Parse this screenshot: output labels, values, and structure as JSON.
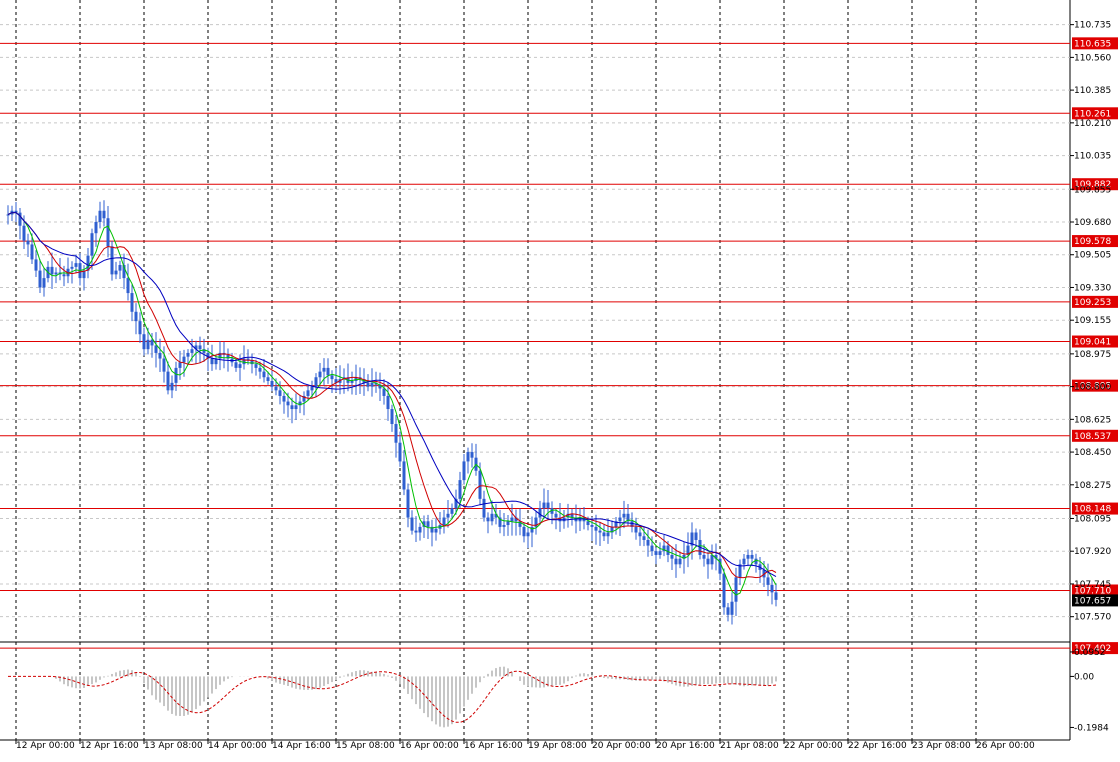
{
  "chart_data": [
    {
      "type": "candlestick",
      "ylim": [
        107.44,
        110.84
      ],
      "y_ticks": [
        "110.735",
        "110.560",
        "110.385",
        "110.210",
        "110.035",
        "109.855",
        "109.680",
        "109.505",
        "109.330",
        "109.155",
        "108.975",
        "108.800",
        "108.625",
        "108.450",
        "108.275",
        "108.095",
        "107.920",
        "107.745",
        "107.570"
      ],
      "y_tick_values": [
        110.735,
        110.56,
        110.385,
        110.21,
        110.035,
        109.855,
        109.68,
        109.505,
        109.33,
        109.155,
        108.975,
        108.8,
        108.625,
        108.45,
        108.275,
        108.095,
        107.92,
        107.745,
        107.57
      ],
      "x_ticks": [
        "12 Apr 00:00",
        "12 Apr 16:00",
        "13 Apr 08:00",
        "14 Apr 00:00",
        "14 Apr 16:00",
        "15 Apr 08:00",
        "16 Apr 00:00",
        "16 Apr 16:00",
        "19 Apr 08:00",
        "20 Apr 00:00",
        "20 Apr 16:00",
        "21 Apr 08:00",
        "22 Apr 00:00",
        "22 Apr 16:00",
        "23 Apr 08:00",
        "26 Apr 00:00"
      ],
      "x_tick_bars": [
        2,
        18,
        34,
        50,
        66,
        82,
        98,
        114,
        130,
        146,
        162,
        178,
        194,
        210,
        226,
        242
      ],
      "grid": true,
      "horizontal_levels": [
        {
          "label": "110.635",
          "value": 110.635
        },
        {
          "label": "110.261",
          "value": 110.261
        },
        {
          "label": "109.882",
          "value": 109.882
        },
        {
          "label": "109.578",
          "value": 109.578
        },
        {
          "label": "109.253",
          "value": 109.253
        },
        {
          "label": "109.041",
          "value": 109.041
        },
        {
          "label": "108.805",
          "value": 108.805
        },
        {
          "label": "108.537",
          "value": 108.537
        },
        {
          "label": "108.148",
          "value": 108.148
        },
        {
          "label": "107.710",
          "value": 107.71
        },
        {
          "label": "107.402",
          "value": 107.402
        }
      ],
      "current_price": {
        "label": "107.657",
        "value": 107.657
      },
      "series": [
        {
          "name": "",
          "values": [
            109.72,
            109.74,
            109.73,
            109.66,
            109.58,
            109.56,
            109.48,
            109.42,
            109.33,
            109.38,
            109.44,
            109.4,
            109.41,
            109.4,
            109.39,
            109.43,
            109.44,
            109.46,
            109.38,
            109.42,
            109.5,
            109.62,
            109.68,
            109.74,
            109.7,
            109.55,
            109.4,
            109.42,
            109.45,
            109.38,
            109.3,
            109.2,
            109.15,
            109.08,
            109.0,
            109.05,
            109.02,
            108.98,
            108.95,
            108.88,
            108.78,
            108.82,
            108.9,
            108.93,
            108.96,
            108.98,
            109.0,
            109.02,
            109.0,
            108.98,
            108.95,
            108.92,
            108.95,
            108.98,
            108.97,
            108.95,
            108.93,
            108.9,
            108.92,
            108.95,
            108.94,
            108.92,
            108.9,
            108.88,
            108.85,
            108.83,
            108.8,
            108.78,
            108.75,
            108.72,
            108.7,
            108.68,
            108.7,
            108.72,
            108.75,
            108.78,
            108.8,
            108.85,
            108.88,
            108.9,
            108.86,
            108.84,
            108.82,
            108.84,
            108.85,
            108.82,
            108.83,
            108.85,
            108.84,
            108.82,
            108.8,
            108.82,
            108.81,
            108.79,
            108.75,
            108.68,
            108.6,
            108.5,
            108.4,
            108.25,
            108.1,
            108.03,
            108.02,
            108.05,
            108.08,
            108.05,
            108.02,
            108.04,
            108.06,
            108.1,
            108.12,
            108.15,
            108.2,
            108.3,
            108.4,
            108.45,
            108.42,
            108.35,
            108.2,
            108.1,
            108.08,
            108.12,
            108.1,
            108.05,
            108.06,
            108.08,
            108.1,
            108.08,
            108.05,
            108.0,
            108.02,
            108.05,
            108.1,
            108.15,
            108.18,
            108.15,
            108.12,
            108.1,
            108.08,
            108.1,
            108.12,
            108.1,
            108.08,
            108.1,
            108.08,
            108.06,
            108.05,
            108.03,
            108.02,
            108.0,
            108.02,
            108.05,
            108.08,
            108.1,
            108.12,
            108.08,
            108.05,
            108.02,
            108.0,
            107.98,
            107.95,
            107.92,
            107.9,
            107.92,
            107.95,
            107.9,
            107.88,
            107.85,
            107.88,
            107.9,
            107.95,
            108.02,
            107.98,
            107.9,
            107.88,
            107.85,
            107.9,
            107.88,
            107.8,
            107.62,
            107.58,
            107.65,
            107.78,
            107.85,
            107.88,
            107.9,
            107.88,
            107.85,
            107.82,
            107.78,
            107.74,
            107.7,
            107.66
          ]
        }
      ]
    },
    {
      "type": "histogram",
      "ylim": [
        -0.22,
        0.13
      ],
      "y_ticks": [
        "0.0952",
        "0.00",
        "-0.1984"
      ],
      "y_tick_values": [
        0.0952,
        0.0,
        -0.1984
      ]
    }
  ],
  "colors": {
    "candle": "#2f5fd0",
    "ma_fast": "#00c000",
    "ma_mid": "#d00000",
    "ma_slow": "#0000c0",
    "level": "#e00000",
    "osc_bar": "#b8b8b8",
    "signal": "#d00000",
    "grid": "#c8c8c8",
    "price_box": "#000000"
  }
}
